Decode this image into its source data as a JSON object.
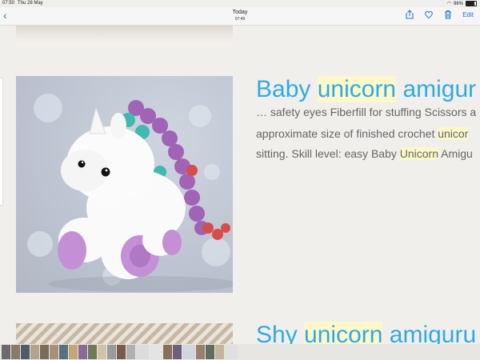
{
  "status": {
    "time": "07:50",
    "date": "Thu 28 May",
    "battery": "96%"
  },
  "nav": {
    "title": "Today",
    "subtitle": "07:49",
    "edit_label": "Edit"
  },
  "result1": {
    "title_pre": "Baby ",
    "title_hl": "unicorn",
    "title_post": " amigur",
    "line1": "… safety eyes Fiberfill for stuffing Scissors a",
    "line2_pre": "approximate size of finished crochet ",
    "line2_hl": "unicor",
    "line3_pre": "sitting. Skill level: easy Baby ",
    "line3_hl": "Unicorn",
    "line3_post": " Amigu"
  },
  "result2": {
    "title_pre": "Shy ",
    "title_hl": "unicorn",
    "title_post": " amiguru"
  },
  "colors": {
    "accent": "#2eaae6",
    "highlight": "#fdf8c9",
    "link": "#1a73e8"
  }
}
